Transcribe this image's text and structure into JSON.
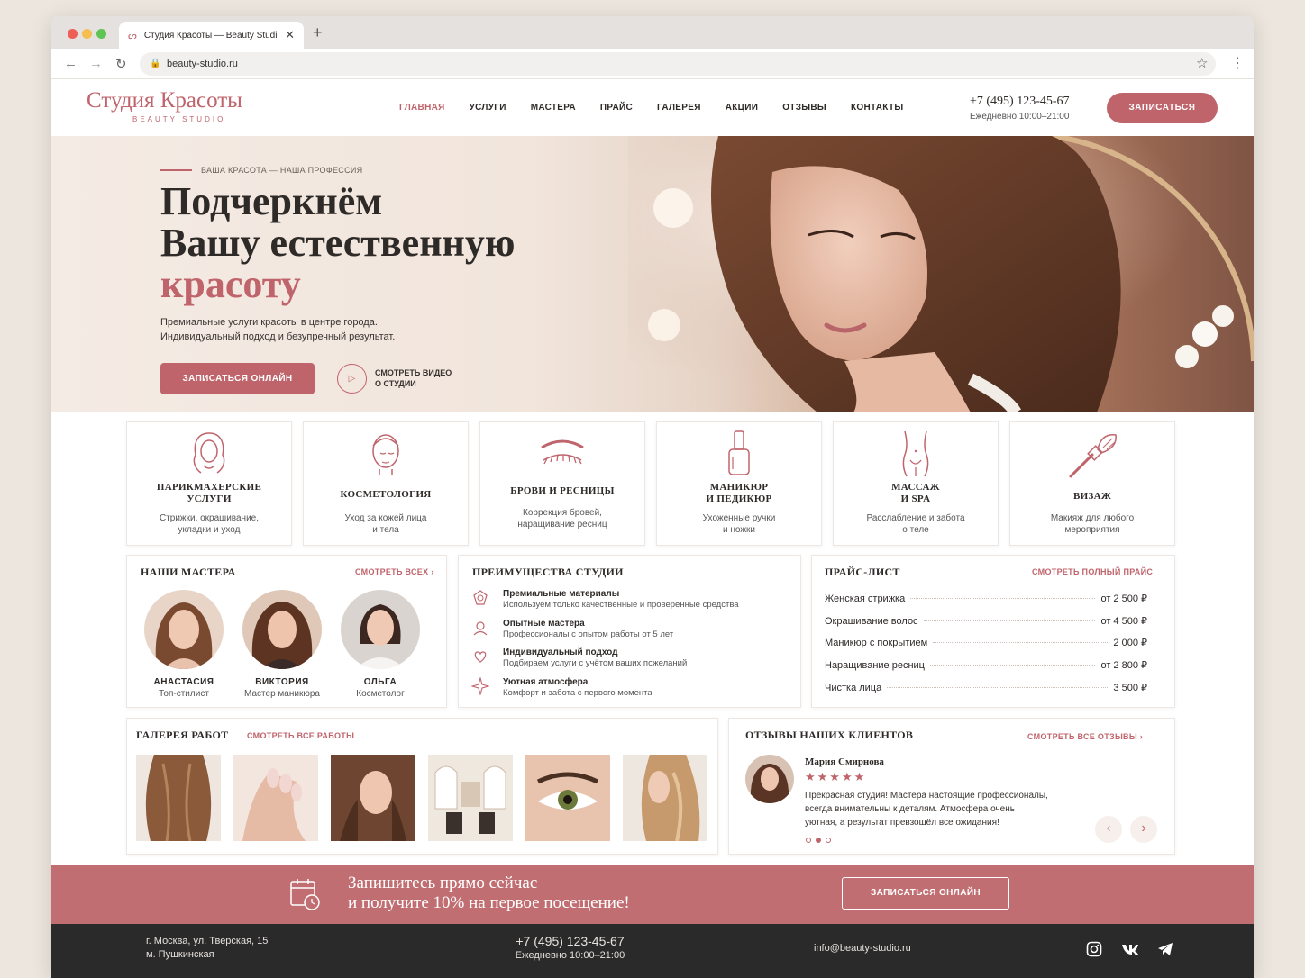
{
  "browser": {
    "tab_title": "Студия Красоты — Beauty Studio",
    "url": "beauty-studio.ru"
  },
  "colors": {
    "accent": "#c0646c",
    "dark": "#2b2a2b",
    "text": "#2e2a28"
  },
  "header": {
    "logo": "Студия Красоты",
    "logo_sub": "BEAUTY STUDIO",
    "nav": [
      "ГЛАВНАЯ",
      "УСЛУГИ",
      "МАСТЕРА",
      "ПРАЙС",
      "ГАЛЕРЕЯ",
      "АКЦИИ",
      "ОТЗЫВЫ",
      "КОНТАКТЫ"
    ],
    "phone": "+7 (495) 123-45-67",
    "hours": "Ежедневно 10:00–21:00",
    "book_label": "ЗАПИСАТЬСЯ"
  },
  "hero": {
    "eyebrow": "ВАША КРАСОТА — НАША ПРОФЕССИЯ",
    "title_line1": "Подчеркнём",
    "title_line2": "Вашу естественную",
    "title_accent": "красоту",
    "text_line1": "Премиальные услуги красоты в центре города.",
    "text_line2": "Индивидуальный подход и безупречный результат.",
    "cta": "ЗАПИСАТЬСЯ ОНЛАЙН",
    "video_line1": "СМОТРЕТЬ ВИДЕО",
    "video_line2": "О СТУДИИ"
  },
  "services": [
    {
      "title": "ПАРИКМАХЕРСКИЕ\nУСЛУГИ",
      "desc": "Стрижки, окрашивание,\nукладки и уход",
      "icon": "hair-icon"
    },
    {
      "title": "КОСМЕТОЛОГИЯ",
      "desc": "Уход за кожей лица\nи тела",
      "icon": "face-icon"
    },
    {
      "title": "БРОВИ И РЕСНИЦЫ",
      "desc": "Коррекция бровей,\nнаращивание ресниц",
      "icon": "eye-lash-icon"
    },
    {
      "title": "МАНИКЮР\nИ ПЕДИКЮР",
      "desc": "Ухоженные ручки\nи ножки",
      "icon": "nail-polish-icon"
    },
    {
      "title": "МАССАЖ\nИ SPA",
      "desc": "Расслабление и забота\nо теле",
      "icon": "body-icon"
    },
    {
      "title": "ВИЗАЖ",
      "desc": "Макияж для любого\nмероприятия",
      "icon": "makeup-brush-icon"
    }
  ],
  "masters": {
    "title": "НАШИ МАСТЕРА",
    "link": "СМОТРЕТЬ ВСЕХ ›",
    "items": [
      {
        "name": "АНАСТАСИЯ",
        "role": "Топ-стилист"
      },
      {
        "name": "ВИКТОРИЯ",
        "role": "Мастер маникюра"
      },
      {
        "name": "ОЛЬГА",
        "role": "Косметолог"
      }
    ]
  },
  "advantages": {
    "title": "ПРЕИМУЩЕСТВА СТУДИИ",
    "items": [
      {
        "title": "Премиальные материалы",
        "desc": "Используем только качественные и проверенные средства"
      },
      {
        "title": "Опытные мастера",
        "desc": "Профессионалы с опытом работы от 5 лет"
      },
      {
        "title": "Индивидуальный подход",
        "desc": "Подбираем услуги с учётом ваших пожеланий"
      },
      {
        "title": "Уютная атмосфера",
        "desc": "Комфорт и забота с первого момента"
      }
    ]
  },
  "prices": {
    "title": "ПРАЙС-ЛИСТ",
    "link": "СМОТРЕТЬ ПОЛНЫЙ ПРАЙС",
    "items": [
      {
        "name": "Женская стрижка",
        "price": "от 2 500 ₽"
      },
      {
        "name": "Окрашивание волос",
        "price": "от 4 500 ₽"
      },
      {
        "name": "Маникюр с покрытием",
        "price": "2 000 ₽"
      },
      {
        "name": "Наращивание ресниц",
        "price": "от 2 800 ₽"
      },
      {
        "name": "Чистка лица",
        "price": "3 500 ₽"
      }
    ]
  },
  "gallery": {
    "title": "ГАЛЕРЕЯ РАБОТ",
    "link": "СМОТРЕТЬ ВСЕ РАБОТЫ"
  },
  "reviews": {
    "title": "ОТЗЫВЫ НАШИХ КЛИЕНТОВ",
    "link": "СМОТРЕТЬ ВСЕ ОТЗЫВЫ ›",
    "author": "Мария Смирнова",
    "rating": 5,
    "stars": "★★★★★",
    "text_line1": "Прекрасная студия! Мастера настоящие профессионалы,",
    "text_line2": "всегда внимательны к деталям. Атмосфера очень",
    "text_line3": "уютная, а результат превзошёл все ожидания!",
    "prev": "‹",
    "next": "›"
  },
  "cta_band": {
    "line1": "Запишитесь прямо сейчас",
    "line2": "и получите 10% на первое посещение!",
    "button": "ЗАПИСАТЬСЯ ОНЛАЙН"
  },
  "footer": {
    "address_line1": "г. Москва, ул. Тверская, 15",
    "address_line2": "м. Пушкинская",
    "phone": "+7 (495) 123-45-67",
    "hours": "Ежедневно 10:00–21:00",
    "email": "info@beauty-studio.ru"
  }
}
